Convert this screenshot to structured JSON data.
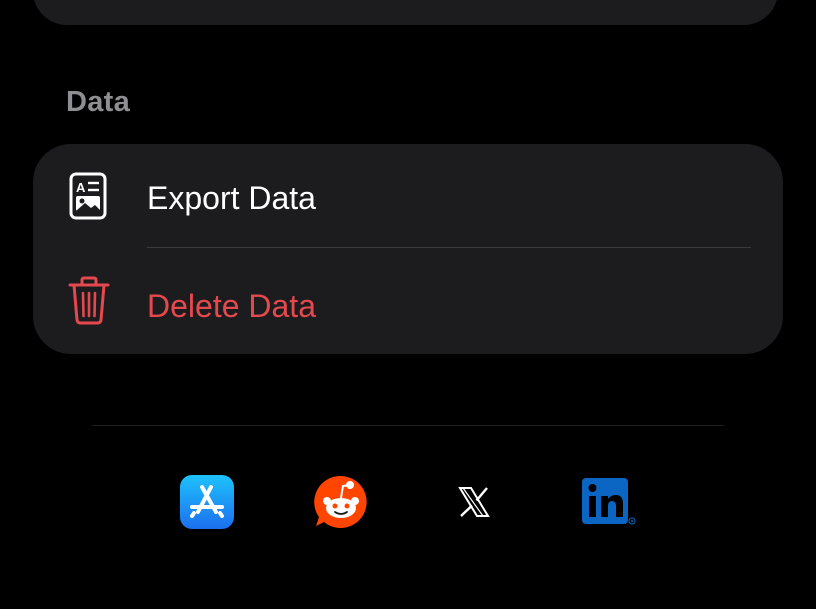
{
  "data_section": {
    "header": "Data",
    "rows": [
      {
        "label": "Export Data",
        "icon": "export-document-icon",
        "color": "#ffffff"
      },
      {
        "label": "Delete Data",
        "icon": "trash-icon",
        "color": "#e5484d"
      }
    ]
  },
  "social_links": [
    {
      "name": "app-store",
      "icon": "app-store-icon",
      "color": "#1c8ef3"
    },
    {
      "name": "reddit",
      "icon": "reddit-icon",
      "color": "#ff4500"
    },
    {
      "name": "x",
      "icon": "x-icon",
      "color": "#ffffff"
    },
    {
      "name": "linkedin",
      "icon": "linkedin-icon",
      "color": "#0a66c2"
    }
  ],
  "colors": {
    "background": "#000000",
    "card": "#1c1c1e",
    "section_header": "#8e8e93",
    "destructive": "#e5484d"
  }
}
